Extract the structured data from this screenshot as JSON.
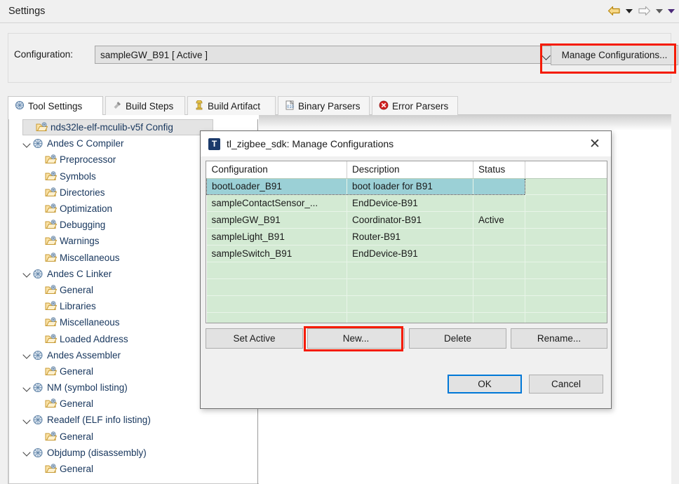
{
  "window": {
    "title": "Settings"
  },
  "nav": {
    "back_icon": "back-arrow-icon",
    "back_dropdown_icon": "chevron-down-icon",
    "forward_icon": "forward-arrow-icon",
    "forward_dropdown_icon": "chevron-down-icon",
    "more_dropdown_icon": "chevron-down-icon"
  },
  "config_bar": {
    "label": "Configuration:",
    "selected_value": "sampleGW_B91  [ Active ]",
    "dropdown_icon": "chevron-down-icon",
    "manage_button": "Manage Configurations...",
    "manage_button_highlight_color": "#f51b00"
  },
  "tabs": [
    {
      "label": "Tool Settings",
      "icon": "tool-settings-icon",
      "active": true
    },
    {
      "label": "Build Steps",
      "icon": "build-steps-icon",
      "active": false
    },
    {
      "label": "Build Artifact",
      "icon": "build-artifact-icon",
      "active": false
    },
    {
      "label": "Binary Parsers",
      "icon": "binary-parsers-icon",
      "active": false
    },
    {
      "label": "Error Parsers",
      "icon": "error-parsers-icon",
      "active": false
    }
  ],
  "tree": [
    {
      "label": "nds32le-elf-mculib-v5f Config",
      "indent": 1,
      "icon": "folder-icon",
      "twisty": "none",
      "selected": true
    },
    {
      "label": "Andes C Compiler",
      "indent": 0,
      "icon": "tool-icon",
      "twisty": "open",
      "selected": false
    },
    {
      "label": "Preprocessor",
      "indent": 1,
      "icon": "folder-icon",
      "twisty": "none",
      "selected": false
    },
    {
      "label": "Symbols",
      "indent": 1,
      "icon": "folder-icon",
      "twisty": "none",
      "selected": false
    },
    {
      "label": "Directories",
      "indent": 1,
      "icon": "folder-icon",
      "twisty": "none",
      "selected": false
    },
    {
      "label": "Optimization",
      "indent": 1,
      "icon": "folder-icon",
      "twisty": "none",
      "selected": false
    },
    {
      "label": "Debugging",
      "indent": 1,
      "icon": "folder-icon",
      "twisty": "none",
      "selected": false
    },
    {
      "label": "Warnings",
      "indent": 1,
      "icon": "folder-icon",
      "twisty": "none",
      "selected": false
    },
    {
      "label": "Miscellaneous",
      "indent": 1,
      "icon": "folder-icon",
      "twisty": "none",
      "selected": false
    },
    {
      "label": "Andes C Linker",
      "indent": 0,
      "icon": "tool-icon",
      "twisty": "open",
      "selected": false
    },
    {
      "label": "General",
      "indent": 1,
      "icon": "folder-icon",
      "twisty": "none",
      "selected": false
    },
    {
      "label": "Libraries",
      "indent": 1,
      "icon": "folder-icon",
      "twisty": "none",
      "selected": false
    },
    {
      "label": "Miscellaneous",
      "indent": 1,
      "icon": "folder-icon",
      "twisty": "none",
      "selected": false
    },
    {
      "label": "Loaded Address",
      "indent": 1,
      "icon": "folder-icon",
      "twisty": "none",
      "selected": false
    },
    {
      "label": "Andes Assembler",
      "indent": 0,
      "icon": "tool-icon",
      "twisty": "open",
      "selected": false
    },
    {
      "label": "General",
      "indent": 1,
      "icon": "folder-icon",
      "twisty": "none",
      "selected": false
    },
    {
      "label": "NM (symbol listing)",
      "indent": 0,
      "icon": "tool-icon",
      "twisty": "open",
      "selected": false
    },
    {
      "label": "General",
      "indent": 1,
      "icon": "folder-icon",
      "twisty": "none",
      "selected": false
    },
    {
      "label": "Readelf (ELF info listing)",
      "indent": 0,
      "icon": "tool-icon",
      "twisty": "open",
      "selected": false
    },
    {
      "label": "General",
      "indent": 1,
      "icon": "folder-icon",
      "twisty": "none",
      "selected": false
    },
    {
      "label": "Objdump (disassembly)",
      "indent": 0,
      "icon": "tool-icon",
      "twisty": "open",
      "selected": false
    },
    {
      "label": "General",
      "indent": 1,
      "icon": "folder-icon",
      "twisty": "none",
      "selected": false
    }
  ],
  "dialog": {
    "icon": "app-logo-icon",
    "icon_letter": "T",
    "title": "tl_zigbee_sdk: Manage Configurations",
    "close_icon": "close-icon",
    "table": {
      "headers": [
        "Configuration",
        "Description",
        "Status",
        ""
      ],
      "rows": [
        {
          "configuration": "bootLoader_B91",
          "description": "boot loader for B91",
          "status": "",
          "selected": true
        },
        {
          "configuration": "sampleContactSensor_...",
          "description": "EndDevice-B91",
          "status": "",
          "selected": false
        },
        {
          "configuration": "sampleGW_B91",
          "description": "Coordinator-B91",
          "status": "Active",
          "selected": false
        },
        {
          "configuration": "sampleLight_B91",
          "description": "Router-B91",
          "status": "",
          "selected": false
        },
        {
          "configuration": "sampleSwitch_B91",
          "description": "EndDevice-B91",
          "status": "",
          "selected": false
        },
        {
          "configuration": "",
          "description": "",
          "status": "",
          "selected": false
        },
        {
          "configuration": "",
          "description": "",
          "status": "",
          "selected": false
        },
        {
          "configuration": "",
          "description": "",
          "status": "",
          "selected": false
        },
        {
          "configuration": "",
          "description": "",
          "status": "",
          "selected": false
        }
      ],
      "selected_row_color": "#9bd0d6",
      "row_color": "#d3ead3"
    },
    "buttons": {
      "set_active": "Set Active",
      "new": "New...",
      "delete": "Delete",
      "rename": "Rename...",
      "new_highlight_color": "#f51b00"
    },
    "footer": {
      "ok": "OK",
      "cancel": "Cancel",
      "default_button_color": "#0078d7"
    }
  }
}
